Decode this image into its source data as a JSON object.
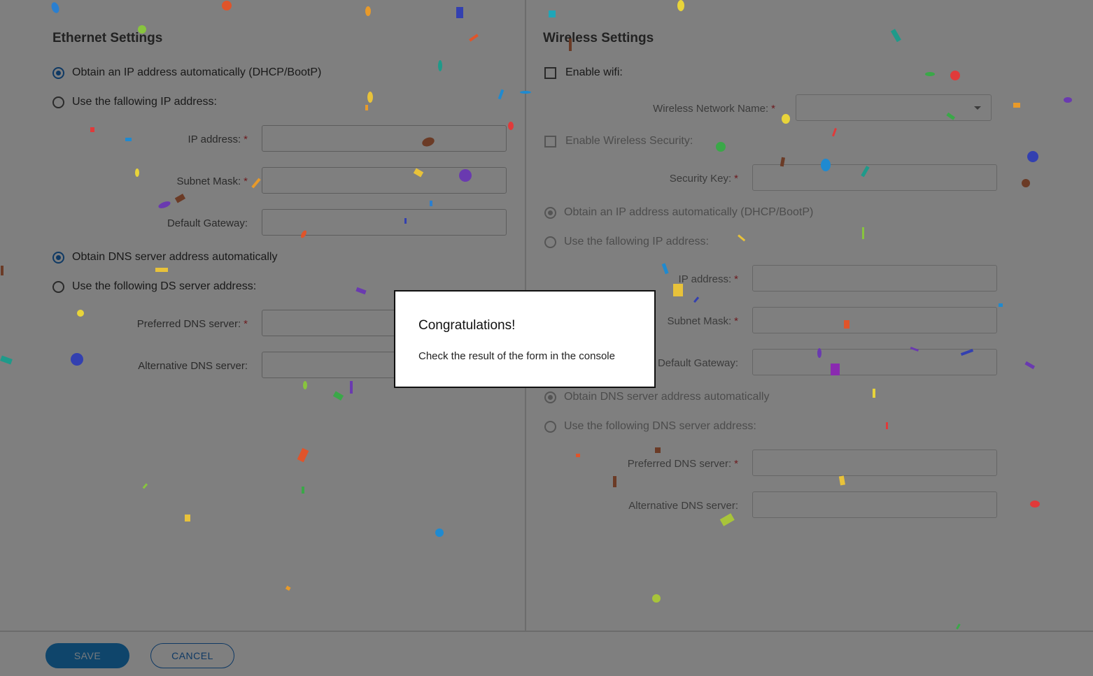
{
  "ethernet": {
    "title": "Ethernet Settings",
    "ip_auto": "Obtain an IP address automatically (DHCP/BootP)",
    "ip_manual": "Use the fallowing IP address:",
    "ip_label": "IP address:",
    "mask_label": "Subnet Mask:",
    "gateway_label": "Default Gateway:",
    "dns_auto": "Obtain DNS server address automatically",
    "dns_manual": "Use the following DS server address:",
    "preferred_dns_label": "Preferred DNS server:",
    "alt_dns_label": "Alternative DNS server:"
  },
  "wireless": {
    "title": "Wireless Settings",
    "enable_wifi": "Enable wifi:",
    "network_name_label": "Wireless Network Name:",
    "enable_security": "Enable Wireless Security:",
    "security_key_label": "Security Key:",
    "ip_auto": "Obtain an IP address automatically (DHCP/BootP)",
    "ip_manual": "Use the fallowing IP address:",
    "ip_label": "IP address:",
    "mask_label": "Subnet Mask:",
    "gateway_label": "Default Gateway:",
    "dns_auto": "Obtain DNS server address automatically",
    "dns_manual": "Use the following DNS server address:",
    "preferred_dns_label": "Preferred DNS server:",
    "alt_dns_label": "Alternative DNS server:"
  },
  "required_mark": "*",
  "footer": {
    "save_label": "SAVE",
    "cancel_label": "CANCEL"
  },
  "dialog": {
    "title": "Congratulations!",
    "message": "Check the result of the form in the console"
  },
  "colors": {
    "accent": "#1e73c8",
    "required": "#d9363e",
    "overlay": "rgba(0,0,0,0.5)"
  }
}
